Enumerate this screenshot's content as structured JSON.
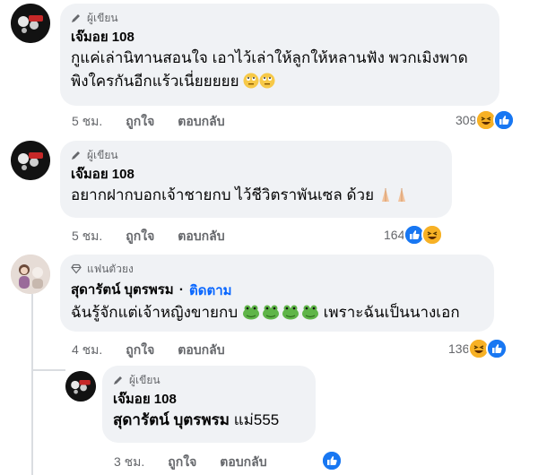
{
  "comments": [
    {
      "badge": "ผู้เขียน",
      "author": "เจ๊มอย 108",
      "lines": [
        "กูแค่เล่านิทานสอนใจ เอาไว้เล่าให้ลูกให้หลานฟัง พวกเมิงพาด",
        "พิงใครกันอีกแร้วเนี่ยยยยย"
      ],
      "time": "5 ชม.",
      "like": "ถูกใจ",
      "reply": "ตอบกลับ",
      "reaction_count": "309"
    },
    {
      "badge": "ผู้เขียน",
      "author": "เจ๊มอย 108",
      "lines": [
        "อยากฝากบอกเจ้าชายกบ ไว้ชีวิตราพันเซล ด้วย"
      ],
      "time": "5 ชม.",
      "like": "ถูกใจ",
      "reply": "ตอบกลับ",
      "reaction_count": "164"
    },
    {
      "badge": "แฟนตัวยง",
      "author": "สุดารัตน์ บุตรพรม",
      "follow": "ติดตาม",
      "lines": [
        "ฉันรู้จักแต่เจ้าหญิงขายกบ",
        "เพราะฉันเป็นนางเอก"
      ],
      "time": "4 ชม.",
      "like": "ถูกใจ",
      "reply": "ตอบกลับ",
      "reaction_count": "136"
    },
    {
      "badge": "ผู้เขียน",
      "author": "เจ๊มอย 108",
      "mention": "สุดารัตน์ บุตรพรม",
      "reply_text": " แม่555",
      "time": "3 ชม.",
      "like": "ถูกใจ",
      "reply": "ตอบกลับ"
    }
  ],
  "colors": {
    "bubble": "#f0f2f5",
    "link": "#0866ff",
    "meta": "#65676b",
    "like": "#1877f2"
  },
  "icons": [
    "pencil-icon",
    "diamond-icon",
    "like-reaction-icon",
    "haha-reaction-icon",
    "frog-emoji",
    "pray-emoji",
    "eyeroll-emoji"
  ]
}
